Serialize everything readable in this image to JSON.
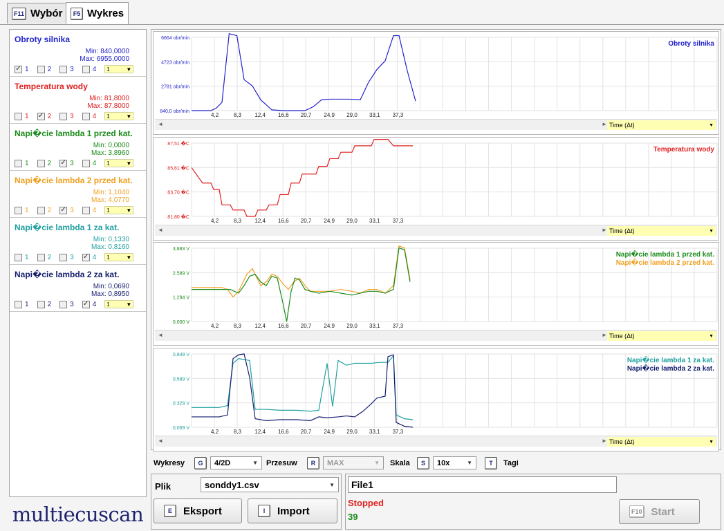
{
  "tabs": [
    {
      "key": "F11",
      "label": "Wybór",
      "active": false
    },
    {
      "key": "F5",
      "label": "Wykres",
      "active": true
    }
  ],
  "signals": [
    {
      "name": "Obroty silnika",
      "color": "#2222cc",
      "min": "Min: 840,0000",
      "max": "Max: 6955,0000",
      "checked": [
        true,
        false,
        false,
        false
      ],
      "select": "1"
    },
    {
      "name": "Temperatura wody",
      "color": "#e02020",
      "min": "Min: 81,8000",
      "max": "Max: 87,8000",
      "checked": [
        false,
        true,
        false,
        false
      ],
      "select": "1"
    },
    {
      "name": "Napi�cie lambda 1 przed kat.",
      "color": "#1a8a1a",
      "min": "Min: 0,0000",
      "max": "Max: 3,8960",
      "checked": [
        false,
        false,
        true,
        false
      ],
      "select": "1"
    },
    {
      "name": "Napi�cie lambda 2 przed kat.",
      "color": "#f0a020",
      "min": "Min: 1,1040",
      "max": "Max: 4,0770",
      "checked": [
        false,
        false,
        true,
        false
      ],
      "select": "1"
    },
    {
      "name": "Napi�cie lambda 1 za kat.",
      "color": "#20a0a0",
      "min": "Min: 0,1330",
      "max": "Max: 0,8160",
      "checked": [
        false,
        false,
        false,
        true
      ],
      "select": "1"
    },
    {
      "name": "Napi�cie lambda 2 za kat.",
      "color": "#141e6e",
      "min": "Min: 0,0690",
      "max": "Max: 0,8950",
      "checked": [
        false,
        false,
        false,
        true
      ],
      "select": "1"
    }
  ],
  "checkbox_labels": [
    "1",
    "2",
    "3",
    "4"
  ],
  "logo": "multiecuscan",
  "time_select": "Time (Δt)",
  "x_ticks": [
    "4,2",
    "8,3",
    "12,4",
    "16,6",
    "20,7",
    "24,9",
    "29,0",
    "33,1",
    "37,3"
  ],
  "charts": [
    {
      "legend": [
        {
          "text": "Obroty silnika",
          "color": "#2222cc"
        }
      ],
      "y_ticks": [
        "6664 obr/min",
        "4723 obr/min",
        "2781 obr/min",
        "840,0 obr/min"
      ],
      "y_tick_color": "#2222cc",
      "ylim": [
        840,
        6664
      ],
      "series": [
        {
          "color": "#2222cc",
          "points": [
            [
              0,
              840
            ],
            [
              3.5,
              840
            ],
            [
              4.5,
              1050
            ],
            [
              5.5,
              1500
            ],
            [
              6.8,
              6955
            ],
            [
              8.2,
              6800
            ],
            [
              9.5,
              3300
            ],
            [
              11,
              2800
            ],
            [
              12.5,
              1700
            ],
            [
              14.5,
              900
            ],
            [
              16.5,
              840
            ],
            [
              18.5,
              840
            ],
            [
              20.5,
              840
            ],
            [
              22,
              1150
            ],
            [
              23.5,
              1700
            ],
            [
              25,
              1750
            ],
            [
              27,
              1750
            ],
            [
              28.5,
              1750
            ],
            [
              30.5,
              1700
            ],
            [
              32,
              3100
            ],
            [
              33.5,
              4100
            ],
            [
              35,
              4800
            ],
            [
              36.5,
              6800
            ],
            [
              37.5,
              6800
            ],
            [
              39,
              4000
            ],
            [
              40.5,
              1600
            ]
          ]
        }
      ]
    },
    {
      "legend": [
        {
          "text": "Temperatura wody",
          "color": "#e02020"
        }
      ],
      "y_ticks": [
        "87,51 �C",
        "85,61 �C",
        "83,70 �C",
        "81,80 �C"
      ],
      "y_tick_color": "#e02020",
      "ylim": [
        81.8,
        87.51
      ],
      "series": [
        {
          "color": "#e02020",
          "points": [
            [
              0,
              85.6
            ],
            [
              2,
              84.4
            ],
            [
              3.5,
              84.4
            ],
            [
              4,
              83.9
            ],
            [
              5,
              83.9
            ],
            [
              5.5,
              82.7
            ],
            [
              7,
              82.7
            ],
            [
              7.5,
              82.3
            ],
            [
              9.5,
              82.3
            ],
            [
              10,
              81.8
            ],
            [
              11.5,
              81.8
            ],
            [
              12,
              82.3
            ],
            [
              13.5,
              82.3
            ],
            [
              14,
              82.7
            ],
            [
              15.5,
              82.7
            ],
            [
              16,
              83.5
            ],
            [
              17.5,
              83.5
            ],
            [
              18,
              84.4
            ],
            [
              19.5,
              84.4
            ],
            [
              20,
              85.1
            ],
            [
              22.5,
              85.1
            ],
            [
              23,
              85.7
            ],
            [
              24.5,
              85.7
            ],
            [
              25,
              86.3
            ],
            [
              26.5,
              86.3
            ],
            [
              27,
              86.8
            ],
            [
              29,
              86.8
            ],
            [
              29.5,
              87.3
            ],
            [
              32.5,
              87.3
            ],
            [
              33,
              87.8
            ],
            [
              35.5,
              87.8
            ],
            [
              36.5,
              87.3
            ],
            [
              40,
              87.3
            ]
          ]
        }
      ]
    },
    {
      "legend": [
        {
          "text": "Napi�cie lambda 1 przed kat.",
          "color": "#1a8a1a"
        },
        {
          "text": "Napi�cie lambda 2 przed kat.",
          "color": "#f0a020"
        }
      ],
      "y_ticks": [
        "3,883 V",
        "2,589 V",
        "1,294 V",
        "0,000 V"
      ],
      "y_tick_color": "#1a8a1a",
      "ylim": [
        0,
        3.883
      ],
      "series": [
        {
          "color": "#f0a020",
          "points": [
            [
              0,
              1.8
            ],
            [
              3,
              1.8
            ],
            [
              5.5,
              1.8
            ],
            [
              6.5,
              1.7
            ],
            [
              7.5,
              1.3
            ],
            [
              8.5,
              1.6
            ],
            [
              10,
              2.5
            ],
            [
              11,
              2.8
            ],
            [
              12.5,
              1.9
            ],
            [
              13.5,
              2.1
            ],
            [
              14.5,
              2.5
            ],
            [
              15.5,
              2.4
            ],
            [
              16.5,
              2.0
            ],
            [
              17.5,
              1.7
            ],
            [
              18.5,
              2.1
            ],
            [
              19.5,
              2.3
            ],
            [
              20.5,
              1.9
            ],
            [
              21.5,
              1.6
            ],
            [
              23,
              1.6
            ],
            [
              25,
              1.6
            ],
            [
              27,
              1.7
            ],
            [
              29,
              1.6
            ],
            [
              30.5,
              1.5
            ],
            [
              32,
              1.7
            ],
            [
              33.5,
              1.7
            ],
            [
              35,
              1.5
            ],
            [
              36.5,
              1.9
            ],
            [
              37.5,
              4.0
            ],
            [
              38.5,
              3.9
            ],
            [
              39.5,
              2.2
            ]
          ]
        },
        {
          "color": "#1a8a1a",
          "points": [
            [
              0,
              1.7
            ],
            [
              3,
              1.7
            ],
            [
              5.5,
              1.7
            ],
            [
              7,
              1.7
            ],
            [
              8.5,
              1.5
            ],
            [
              9.5,
              1.9
            ],
            [
              10.5,
              2.4
            ],
            [
              11.5,
              2.5
            ],
            [
              12.5,
              2.1
            ],
            [
              13.5,
              1.9
            ],
            [
              14.5,
              2.4
            ],
            [
              15.5,
              2.3
            ],
            [
              16.5,
              1.0
            ],
            [
              17.2,
              0.0
            ],
            [
              18,
              1.6
            ],
            [
              18.7,
              2.3
            ],
            [
              19.5,
              2.2
            ],
            [
              20.5,
              1.7
            ],
            [
              21.5,
              1.6
            ],
            [
              23,
              1.5
            ],
            [
              25,
              1.6
            ],
            [
              27,
              1.5
            ],
            [
              29,
              1.4
            ],
            [
              30.5,
              1.5
            ],
            [
              32,
              1.6
            ],
            [
              33.5,
              1.6
            ],
            [
              35,
              1.5
            ],
            [
              36.5,
              1.7
            ],
            [
              37.5,
              3.9
            ],
            [
              38.5,
              3.8
            ],
            [
              39.5,
              2.1
            ]
          ]
        }
      ]
    },
    {
      "legend": [
        {
          "text": "Napi�cie lambda 1 za kat.",
          "color": "#20a0a0"
        },
        {
          "text": "Napi�cie lambda 2 za kat.",
          "color": "#141e6e"
        }
      ],
      "y_ticks": [
        "0,849 V",
        "0,589 V",
        "0,329 V",
        "0,069 V"
      ],
      "y_tick_color": "#20a0a0",
      "ylim": [
        0.069,
        0.849
      ],
      "series": [
        {
          "color": "#20a0a0",
          "points": [
            [
              0,
              0.28
            ],
            [
              5,
              0.28
            ],
            [
              6.5,
              0.3
            ],
            [
              7.5,
              0.75
            ],
            [
              8.5,
              0.8
            ],
            [
              9.5,
              0.79
            ],
            [
              10.5,
              0.78
            ],
            [
              11.5,
              0.26
            ],
            [
              13.5,
              0.26
            ],
            [
              16,
              0.25
            ],
            [
              19,
              0.25
            ],
            [
              21.5,
              0.24
            ],
            [
              23,
              0.25
            ],
            [
              24.5,
              0.75
            ],
            [
              25.5,
              0.29
            ],
            [
              26.5,
              0.78
            ],
            [
              28,
              0.73
            ],
            [
              29.5,
              0.75
            ],
            [
              31,
              0.75
            ],
            [
              32.5,
              0.75
            ],
            [
              34,
              0.76
            ],
            [
              35.5,
              0.76
            ],
            [
              36.5,
              0.83
            ],
            [
              37,
              0.2
            ],
            [
              38.5,
              0.16
            ],
            [
              40,
              0.15
            ]
          ]
        },
        {
          "color": "#141e6e",
          "points": [
            [
              0,
              0.18
            ],
            [
              5,
              0.18
            ],
            [
              6.5,
              0.2
            ],
            [
              7.5,
              0.8
            ],
            [
              8.5,
              0.84
            ],
            [
              9.5,
              0.85
            ],
            [
              10.5,
              0.6
            ],
            [
              11.5,
              0.16
            ],
            [
              13.5,
              0.14
            ],
            [
              16,
              0.15
            ],
            [
              19,
              0.15
            ],
            [
              21.5,
              0.14
            ],
            [
              23,
              0.18
            ],
            [
              24.5,
              0.17
            ],
            [
              26.5,
              0.18
            ],
            [
              28,
              0.19
            ],
            [
              29.5,
              0.18
            ],
            [
              31,
              0.24
            ],
            [
              32.5,
              0.32
            ],
            [
              33.5,
              0.38
            ],
            [
              35,
              0.4
            ],
            [
              35.5,
              0.82
            ],
            [
              36.5,
              0.84
            ],
            [
              37,
              0.12
            ],
            [
              38.5,
              0.08
            ],
            [
              40,
              0.07
            ]
          ]
        }
      ]
    }
  ],
  "controls": {
    "wykresy_label": "Wykresy",
    "wykresy_key": "G",
    "wykresy_value": "4/2D",
    "przesuw_label": "Przesuw",
    "przesuw_key": "R",
    "przesuw_value": "MAX",
    "skala_label": "Skala",
    "skala_key": "S",
    "skala_value": "10x",
    "tagi_key": "T",
    "tagi_label": "Tagi"
  },
  "file_panel": {
    "plik_label": "Plik",
    "file_value": "sonddy1.csv",
    "eksport_key": "E",
    "eksport_label": "Eksport",
    "import_key": "I",
    "import_label": "Import"
  },
  "status_panel": {
    "file_name": "File1",
    "status": "Stopped",
    "status_color": "#e02020",
    "count": "39",
    "count_color": "#1a8a1a",
    "start_key": "F10",
    "start_label": "Start"
  }
}
